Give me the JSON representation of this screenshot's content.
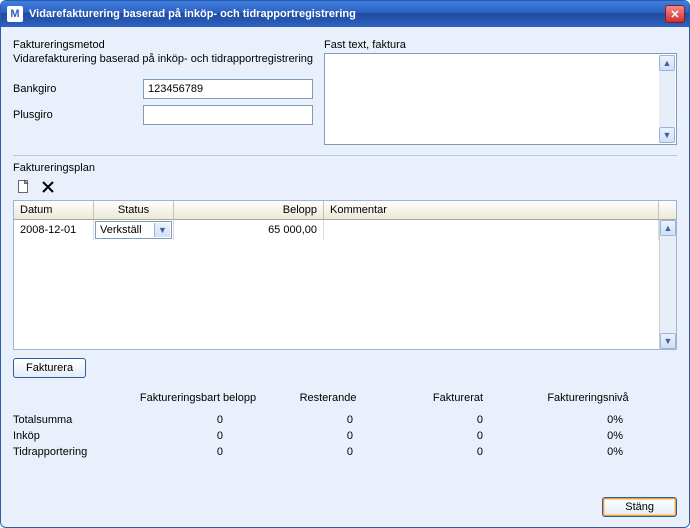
{
  "window": {
    "title": "Vidarefakturering baserad på inköp- och tidrapportregistrering"
  },
  "labels": {
    "method": "Faktureringsmetod",
    "method_value": "Vidarefakturering baserad på inköp- och tidrapportregistrering",
    "bankgiro": "Bankgiro",
    "plusgiro": "Plusgiro",
    "fixed_text": "Fast text, faktura",
    "plan": "Faktureringsplan",
    "invoice_btn": "Fakturera",
    "close_btn": "Stäng"
  },
  "fields": {
    "bankgiro": "123456789",
    "plusgiro": "",
    "fixed_text": ""
  },
  "grid": {
    "headers": {
      "date": "Datum",
      "status": "Status",
      "amount": "Belopp",
      "comment": "Kommentar"
    },
    "row": {
      "date": "2008-12-01",
      "status": "Verkställ",
      "amount": "65 000,00",
      "comment": ""
    }
  },
  "summary": {
    "headers": {
      "billable": "Faktureringsbart belopp",
      "remaining": "Resterande",
      "invoiced": "Fakturerat",
      "level": "Faktureringsnivå"
    },
    "rows": {
      "total": {
        "label": "Totalsumma",
        "billable": "0",
        "remaining": "0",
        "invoiced": "0",
        "level": "0%"
      },
      "purchase": {
        "label": "Inköp",
        "billable": "0",
        "remaining": "0",
        "invoiced": "0",
        "level": "0%"
      },
      "time": {
        "label": "Tidrapportering",
        "billable": "0",
        "remaining": "0",
        "invoiced": "0",
        "level": "0%"
      }
    }
  }
}
